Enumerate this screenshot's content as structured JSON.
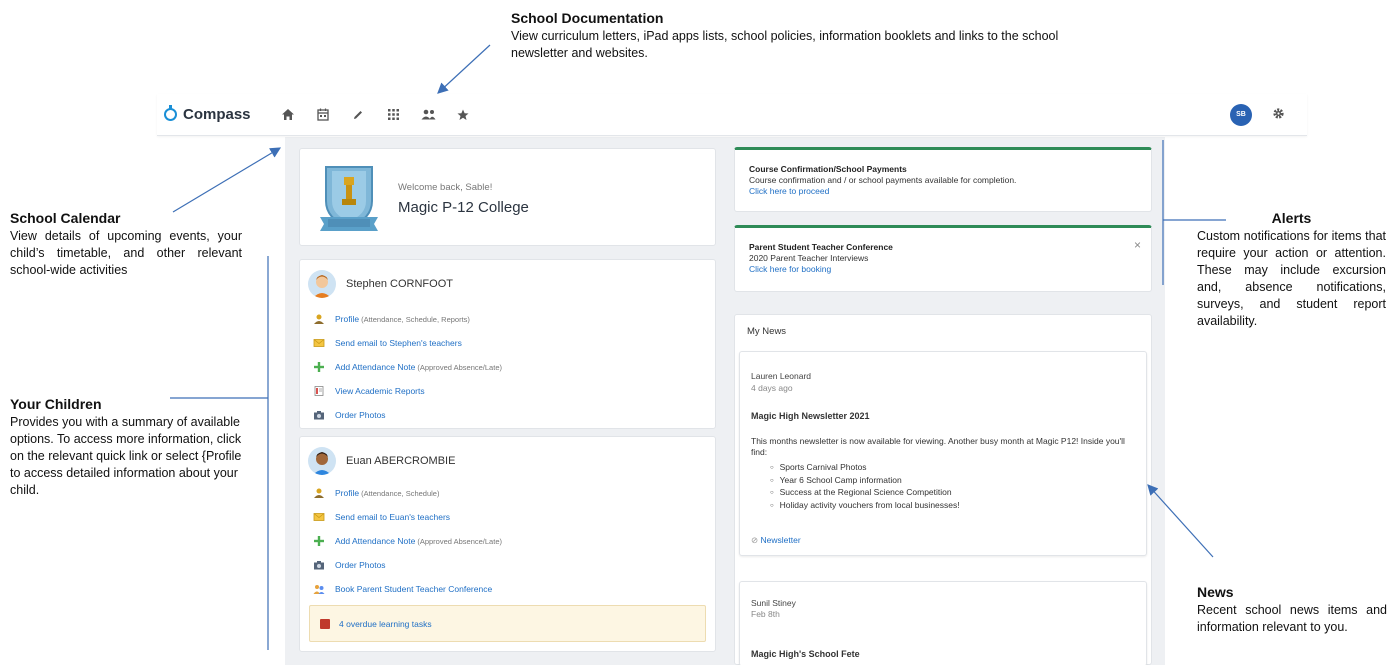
{
  "callouts": {
    "documentation": {
      "title": "School Documentation",
      "text": "View curriculum letters, iPad apps lists, school policies, information booklets and links to the school newsletter and websites."
    },
    "calendar": {
      "title": "School Calendar",
      "text": "View details of upcoming events, your child’s timetable, and other relevant school-wide activities"
    },
    "children": {
      "title": "Your Children",
      "text": "Provides you with a summary of available options. To access more information, click on the relevant quick link or select {Profile to access detailed information about your child."
    },
    "alerts": {
      "title": "Alerts",
      "text": "Custom notifications for items that require your action or attention. These may include excursion and, absence notifications, surveys, and student report availability."
    },
    "news": {
      "title": "News",
      "text": "Recent school news items and information relevant to you."
    }
  },
  "app": {
    "name": "Compass",
    "nav_icons": [
      "home-icon",
      "calendar-icon",
      "pencil-icon",
      "grid-icon",
      "people-icon",
      "star-icon"
    ],
    "user_initials": "SB"
  },
  "school": {
    "welcome": "Welcome back, Sable!",
    "name": "Magic P-12 College"
  },
  "children": [
    {
      "name": "Stephen CORNFOOT",
      "links": [
        {
          "label": "Profile",
          "note": "(Attendance, Schedule, Reports)"
        },
        {
          "label": "Send email to Stephen's teachers",
          "note": ""
        },
        {
          "label": "Add Attendance Note",
          "note": "(Approved Absence/Late)"
        },
        {
          "label": "View Academic Reports",
          "note": ""
        },
        {
          "label": "Order Photos",
          "note": ""
        }
      ]
    },
    {
      "name": "Euan ABERCROMBIE",
      "links": [
        {
          "label": "Profile",
          "note": "(Attendance, Schedule)"
        },
        {
          "label": "Send email to Euan's teachers",
          "note": ""
        },
        {
          "label": "Add Attendance Note",
          "note": "(Approved Absence/Late)"
        },
        {
          "label": "Order Photos",
          "note": ""
        },
        {
          "label": "Book Parent Student Teacher Conference",
          "note": ""
        }
      ],
      "overdue": "4 overdue learning tasks"
    }
  ],
  "alerts": [
    {
      "title": "Course Confirmation/School Payments",
      "body": "Course confirmation and / or school payments available for completion.",
      "link": "Click here to proceed"
    },
    {
      "title": "Parent Student Teacher Conference",
      "body": "2020 Parent Teacher Interviews",
      "link": "Click here for booking",
      "close": "×"
    }
  ],
  "news": {
    "title": "My News",
    "items": [
      {
        "author": "Lauren Leonard",
        "date": "4 days ago",
        "title": "Magic High Newsletter 2021",
        "body": "This months newsletter is now available for viewing. Another busy month at Magic P12! Inside you'll find:",
        "bullets": [
          "Sports Carnival Photos",
          "Year 6 School Camp information",
          "Success at the Regional Science Competition",
          "Holiday activity vouchers from local businesses!"
        ],
        "link": "Newsletter"
      },
      {
        "author": "Sunil Stiney",
        "date": "Feb 8th",
        "title": "Magic High's School Fete"
      }
    ]
  }
}
